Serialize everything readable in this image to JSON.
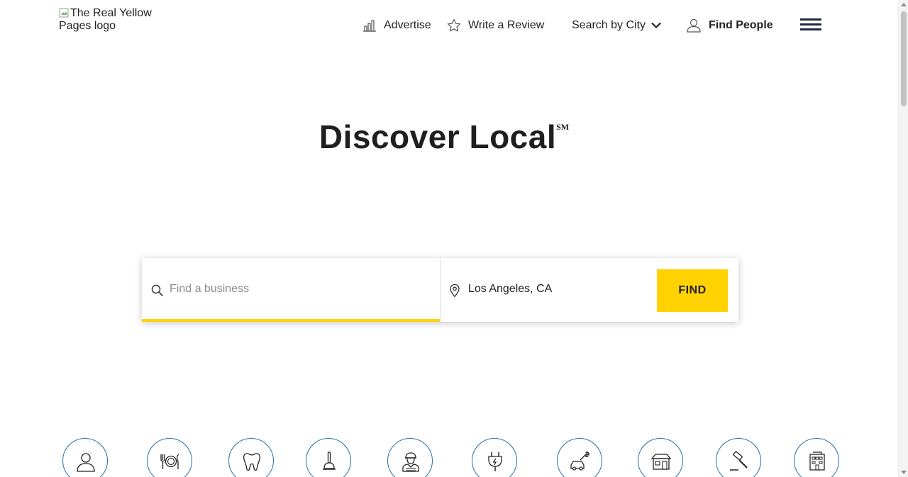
{
  "header": {
    "logo_alt": "The Real Yellow Pages logo",
    "nav": {
      "advertise": "Advertise",
      "write_review": "Write a Review",
      "search_city": "Search by City",
      "find_people": "Find People"
    }
  },
  "hero": {
    "title": "Discover Local",
    "mark": "SM"
  },
  "search": {
    "business_placeholder": "Find a business",
    "location_value": "Los Angeles, CA",
    "find_label": "FIND"
  },
  "categories": {
    "icons": [
      "person-icon",
      "restaurant-icon",
      "tooth-icon",
      "plunger-icon",
      "worker-icon",
      "electrical-plug-icon",
      "auto-repair-icon",
      "store-icon",
      "gavel-icon",
      "building-icon"
    ]
  },
  "colors": {
    "accent": "#ffd200",
    "category_ring": "#2a6fa8",
    "menu": "#1e2a44"
  }
}
